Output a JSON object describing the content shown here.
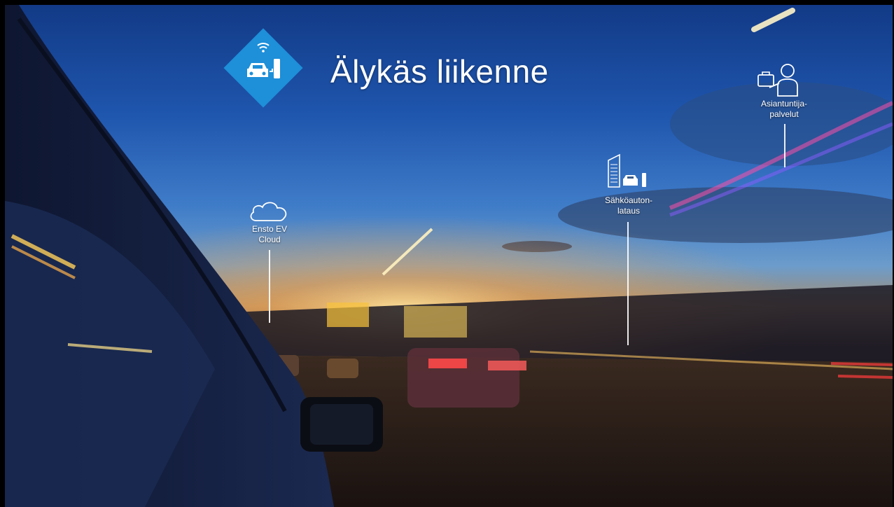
{
  "slide": {
    "title": "Älykäs liikenne",
    "icons": {
      "logo": "car-charging-diamond-icon",
      "cloud": "cloud-icon",
      "charging": "building-car-charger-icon",
      "expert": "person-briefcase-icon"
    },
    "labels": {
      "cloud_line1": "Ensto EV",
      "cloud_line2": "Cloud",
      "charging_line1": "Sähköauton-",
      "charging_line2": "lataus",
      "expert_line1": "Asiantuntija-",
      "expert_line2": "palvelut"
    },
    "colors": {
      "accent": "#1e8fd9",
      "text": "#ffffff"
    }
  }
}
